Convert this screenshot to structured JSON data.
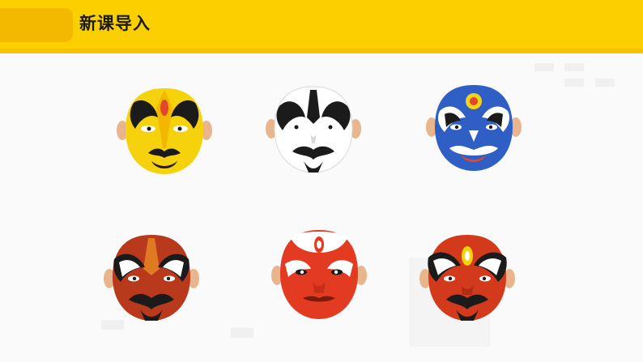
{
  "header": {
    "title": "新课导入",
    "bar_color": "#fcd000",
    "tab_color": "#f3b800"
  },
  "masks": [
    {
      "name": "mask-yellow-face",
      "main": "#f6d20c",
      "pattern": "#1b1b1b"
    },
    {
      "name": "mask-white-face",
      "main": "#ffffff",
      "pattern": "#1b1b1b"
    },
    {
      "name": "mask-blue-face",
      "main": "#2f5fc4",
      "pattern": "#ffffff"
    },
    {
      "name": "mask-red-black-face",
      "main": "#b8391b",
      "pattern": "#1b1b1b"
    },
    {
      "name": "mask-red-white-face",
      "main": "#e23b22",
      "pattern": "#ffffff"
    },
    {
      "name": "mask-red-face",
      "main": "#d33a1c",
      "pattern": "#1b1b1b"
    }
  ]
}
